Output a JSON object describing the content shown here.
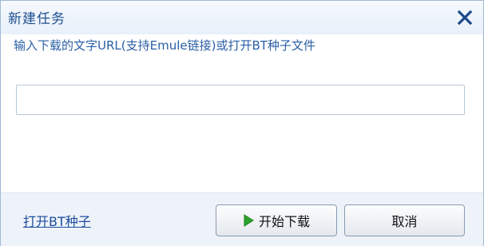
{
  "dialog": {
    "title": "新建任务",
    "close_icon": "close-icon",
    "prompt": "输入下载的文字URL(支持Emule链接)或打开BT种子文件",
    "url_input": {
      "value": "",
      "placeholder": ""
    },
    "footer": {
      "open_bt_link": "打开BT种子",
      "start_button": "开始下载",
      "start_icon": "play-icon",
      "cancel_button": "取消"
    }
  },
  "colors": {
    "title_text": "#1e4f91",
    "prompt_text": "#2a5fa6",
    "link_text": "#1d4d9a",
    "close_icon": "#1a4a8c",
    "play_icon": "#2aa52a",
    "footer_bg": "#eef3fa"
  }
}
